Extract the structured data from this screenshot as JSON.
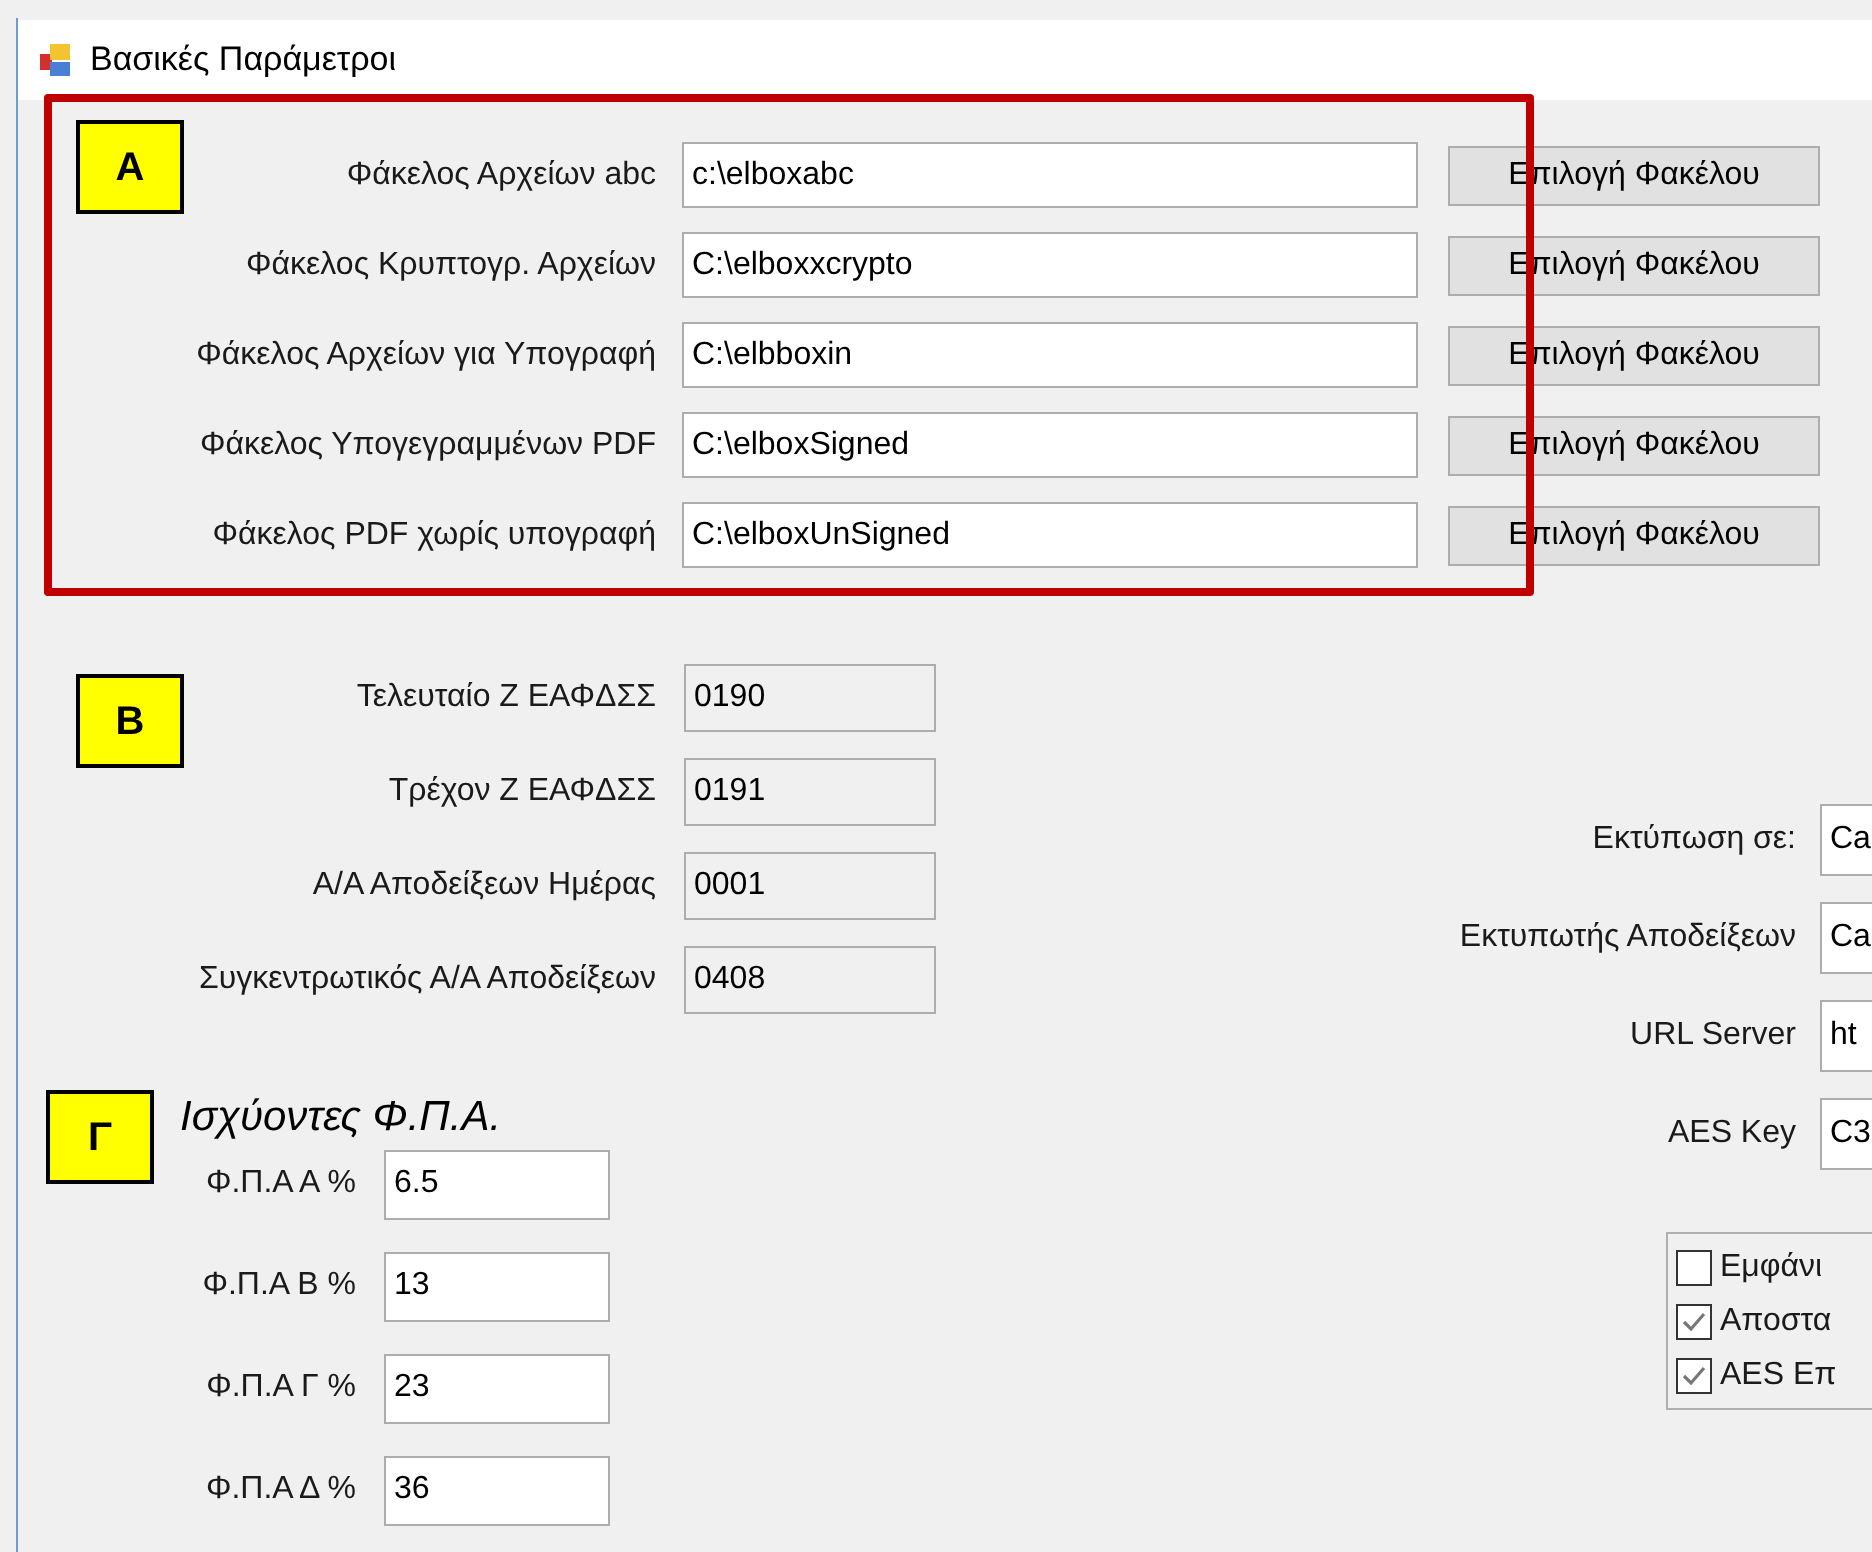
{
  "window": {
    "title": "Βασικές Παράμετροι"
  },
  "annotations": [
    {
      "label": "Α"
    },
    {
      "label": "Β"
    },
    {
      "label": "Γ"
    }
  ],
  "folders": [
    {
      "label": "Φάκελος Αρχείων abc",
      "value": "c:\\elboxabc",
      "button": "Επιλογή Φακέλου"
    },
    {
      "label": "Φάκελος Κρυπτογρ. Αρχείων",
      "value": "C:\\elboxxcrypto",
      "button": "Επιλογή Φακέλου"
    },
    {
      "label": "Φάκελος Αρχείων για Υπογραφή",
      "value": "C:\\elbboxin",
      "button": "Επιλογή Φακέλου"
    },
    {
      "label": "Φάκελος Υπογεγραμμένων PDF",
      "value": "C:\\elboxSigned",
      "button": "Επιλογή Φακέλου"
    },
    {
      "label": "Φάκελος PDF χωρίς υπογραφή",
      "value": "C:\\elboxUnSigned",
      "button": "Επιλογή Φακέλου"
    }
  ],
  "counters": [
    {
      "label": "Τελευταίο Ζ ΕΑΦΔΣΣ",
      "value": "0190"
    },
    {
      "label": "Τρέχον Ζ ΕΑΦΔΣΣ",
      "value": "0191"
    },
    {
      "label": "Α/Α Αποδείξεων Ημέρας",
      "value": "0001"
    },
    {
      "label": "Συγκεντρωτικός Α/Α Αποδείξεων",
      "value": "0408"
    }
  ],
  "vat": {
    "title": "Ισχύοντες Φ.Π.Α.",
    "rates": [
      {
        "label": "Φ.Π.Α Α %",
        "value": "6.5"
      },
      {
        "label": "Φ.Π.Α Β %",
        "value": "13"
      },
      {
        "label": "Φ.Π.Α Γ %",
        "value": "23"
      },
      {
        "label": "Φ.Π.Α Δ %",
        "value": "36"
      }
    ]
  },
  "printing": [
    {
      "label": "Εκτύπωση σε:",
      "value": "Ca"
    },
    {
      "label": "Εκτυπωτής Αποδείξεων",
      "value": "Ca"
    },
    {
      "label": "URL Server",
      "value": "ht"
    },
    {
      "label": "AES Key",
      "value": "C3"
    }
  ],
  "options": [
    {
      "label": "Εμφάνι",
      "checked": false
    },
    {
      "label": "Αποστα",
      "checked": true
    },
    {
      "label": "AES Επ",
      "checked": true
    }
  ]
}
